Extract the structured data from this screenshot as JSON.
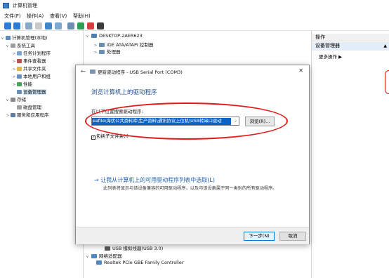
{
  "window": {
    "title": "计算机管理",
    "icon": "computer-management-icon"
  },
  "menu": [
    "文件(F)",
    "操作(A)",
    "查看(V)",
    "帮助(H)"
  ],
  "left_tree": {
    "items": [
      {
        "label": "计算机管理(本地)",
        "level": 0,
        "expander": "v",
        "icon": "computer-icon"
      },
      {
        "label": "系统工具",
        "level": 1,
        "expander": "v",
        "icon": "tools-icon"
      },
      {
        "label": "任务计划程序",
        "level": 2,
        "expander": ">",
        "icon": "task-scheduler-icon"
      },
      {
        "label": "事件查看器",
        "level": 2,
        "expander": ">",
        "icon": "event-viewer-icon"
      },
      {
        "label": "共享文件夹",
        "level": 2,
        "expander": ">",
        "icon": "shared-folder-icon"
      },
      {
        "label": "本地用户和组",
        "level": 2,
        "expander": ">",
        "icon": "users-icon"
      },
      {
        "label": "性能",
        "level": 2,
        "expander": ">",
        "icon": "performance-icon"
      },
      {
        "label": "设备管理器",
        "level": 2,
        "expander": "",
        "icon": "device-manager-icon",
        "selected": true
      },
      {
        "label": "存储",
        "level": 1,
        "expander": "v",
        "icon": "storage-icon"
      },
      {
        "label": "磁盘管理",
        "level": 2,
        "expander": "",
        "icon": "disk-icon"
      },
      {
        "label": "服务和应用程序",
        "level": 1,
        "expander": ">",
        "icon": "services-icon"
      }
    ]
  },
  "device_list": {
    "root": "DESKTOP-2AER623",
    "top_items": [
      "IDE ATA/ATAPI 控制器",
      "处理器"
    ],
    "bottom_items": [
      {
        "label": "USB 模拟线器(USB 3.0)",
        "level": 2
      },
      {
        "label": "网络适配器",
        "level": 1,
        "expander": "v"
      },
      {
        "label": "Realtek PCIe GBE Family Controller",
        "level": 2
      }
    ]
  },
  "actions_pane": {
    "header": "操作",
    "section": "设备管理器",
    "more": "更多操作"
  },
  "dialog": {
    "title": "更新驱动程序 - USB Serial Port (COM3)",
    "heading": "浏览计算机上的驱动程序",
    "search_label": "在以下位置搜索驱动程序:",
    "path_value": "eafile\\海伏公共资料库\\生产资料\\通讯协议上位机\\USB转串口驱动",
    "browse_label": "浏览(R)...",
    "include_subfolders_label": "包括子文件夹(I)",
    "include_subfolders_checked": true,
    "pick_link": "→ 让我从计算机上的可用驱动程序列表中选取(L)",
    "pick_desc": "此列表将显示与该设备兼容的可用驱动程序，以及与该设备属于同一类别的所有驱动程序。",
    "next_label": "下一步(N)",
    "cancel_label": "取消"
  },
  "colors": {
    "accent": "#0a64c8",
    "annotation": "#e11b1b",
    "link": "#1f5fae",
    "selection": "#cce4f7"
  }
}
